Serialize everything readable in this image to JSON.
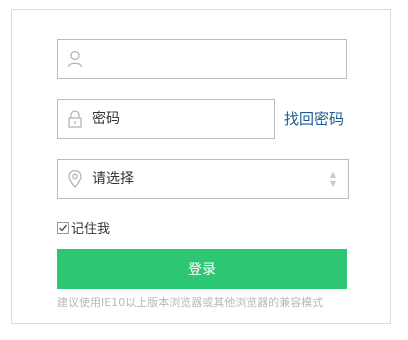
{
  "form": {
    "username": {
      "icon": "user-icon",
      "placeholder": "",
      "value": ""
    },
    "password": {
      "icon": "lock-icon",
      "placeholder": "密码",
      "value": ""
    },
    "forgot_password_label": "找回密码",
    "region": {
      "icon": "location-pin-icon",
      "selected": "请选择",
      "arrow_up": "▲",
      "arrow_down": "▼"
    },
    "remember_me_label": "记住我",
    "remember_me_checked": true,
    "login_label": "登录",
    "browser_hint": "建议使用IE10以上版本浏览器或其他浏览器的兼容模式"
  },
  "colors": {
    "accent": "#2dc773",
    "link": "#1a5a96",
    "border": "#bdbdbd",
    "hint": "#b8b8b8"
  }
}
